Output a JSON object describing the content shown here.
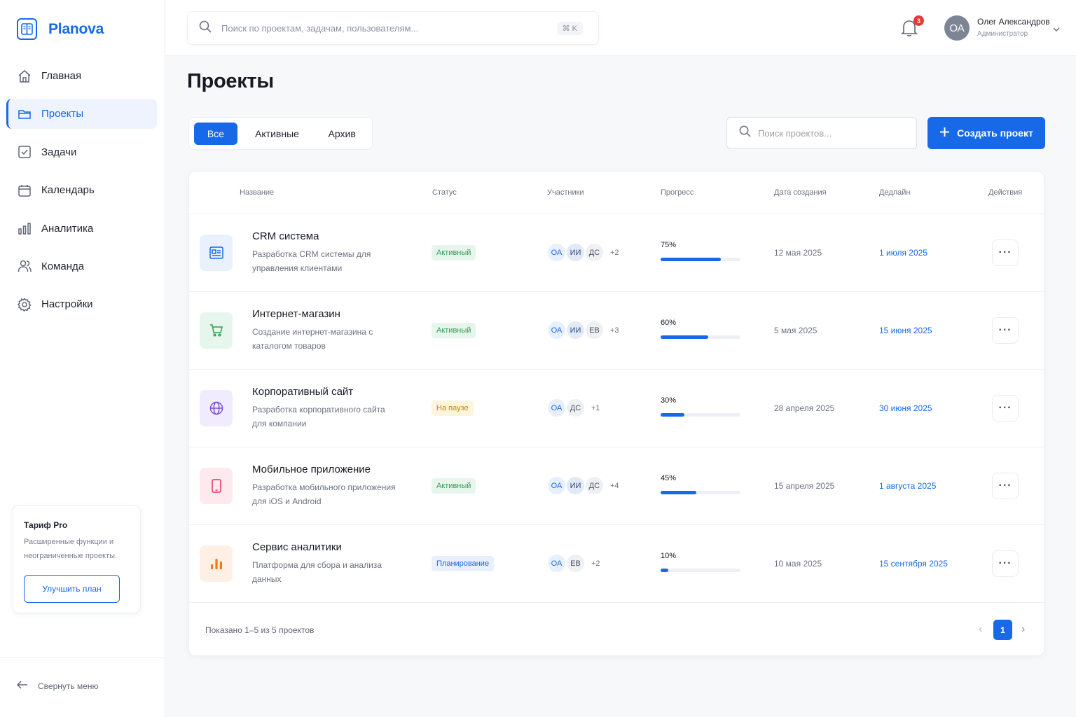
{
  "brand": {
    "name": "Planova"
  },
  "sidebar": {
    "items": [
      {
        "label": "Главная",
        "icon": "home-icon"
      },
      {
        "label": "Проекты",
        "icon": "folder-icon"
      },
      {
        "label": "Задачи",
        "icon": "checkbox-icon"
      },
      {
        "label": "Календарь",
        "icon": "calendar-icon"
      },
      {
        "label": "Аналитика",
        "icon": "bar-chart-icon"
      },
      {
        "label": "Команда",
        "icon": "users-icon"
      },
      {
        "label": "Настройки",
        "icon": "gear-icon"
      }
    ],
    "active_index": 1,
    "plan": {
      "title": "Тариф Pro",
      "description": "Расширенные функции и неограниченные проекты.",
      "button": "Улучшить план"
    },
    "collapse_label": "Свернуть меню"
  },
  "topbar": {
    "search_placeholder": "Поиск по проектам, задачам, пользователям...",
    "shortcut": "⌘ K",
    "notifications_count": "3",
    "user": {
      "initials": "ОА",
      "name": "Олег Александров",
      "role": "Администратор"
    }
  },
  "page": {
    "title": "Проекты",
    "tabs": [
      "Все",
      "Активные",
      "Архив"
    ],
    "active_tab": 0,
    "search_placeholder": "Поиск проектов...",
    "create_button": "Создать проект"
  },
  "table": {
    "columns": [
      "Название",
      "Статус",
      "Участники",
      "Прогресс",
      "Дата создания",
      "Дедлайн",
      "Действия"
    ],
    "rows": [
      {
        "name": "CRM система",
        "description": "Разработка CRM системы для управления клиентами",
        "icon": "crm-card-icon",
        "status": "Активный",
        "status_type": "active",
        "members": [
          "ОА",
          "ИИ",
          "ДС"
        ],
        "members_more": "+2",
        "progress": 75,
        "progress_label": "75%",
        "created": "12 мая 2025",
        "deadline": "1 июля 2025"
      },
      {
        "name": "Интернет-магазин",
        "description": "Создание интернет-магазина с каталогом товаров",
        "icon": "cart-icon",
        "status": "Активный",
        "status_type": "active",
        "members": [
          "ОА",
          "ИИ",
          "ЕВ"
        ],
        "members_more": "+3",
        "progress": 60,
        "progress_label": "60%",
        "created": "5 мая 2025",
        "deadline": "15 июня 2025"
      },
      {
        "name": "Корпоративный сайт",
        "description": "Разработка корпоративного сайта для компании",
        "icon": "globe-icon",
        "status": "На паузе",
        "status_type": "paused",
        "members": [
          "ОА",
          "ДС"
        ],
        "members_more": "+1",
        "progress": 30,
        "progress_label": "30%",
        "created": "28 апреля 2025",
        "deadline": "30 июня 2025"
      },
      {
        "name": "Мобильное приложение",
        "description": "Разработка мобильного приложения для iOS и Android",
        "icon": "smartphone-icon",
        "status": "Активный",
        "status_type": "active",
        "members": [
          "ОА",
          "ИИ",
          "ДС"
        ],
        "members_more": "+4",
        "progress": 45,
        "progress_label": "45%",
        "created": "15 апреля 2025",
        "deadline": "1 августа 2025"
      },
      {
        "name": "Сервис аналитики",
        "description": "Платформа для сбора и анализа данных",
        "icon": "analytics-bars-icon",
        "status": "Планирование",
        "status_type": "planning",
        "members": [
          "ОА",
          "ЕВ"
        ],
        "members_more": "+2",
        "progress": 10,
        "progress_label": "10%",
        "created": "10 мая 2025",
        "deadline": "15 сентября 2025"
      }
    ],
    "footer_text": "Показано 1–5 из 5 проектов",
    "current_page": "1"
  },
  "colors": {
    "accent": "#1769E8",
    "status_active_bg": "#E7F6EC",
    "status_active_fg": "#2E9D4F",
    "status_paused_bg": "#FFF4DC",
    "status_paused_fg": "#C98A0B",
    "status_planning_bg": "#E8F0FD",
    "status_planning_fg": "#1769E8"
  }
}
